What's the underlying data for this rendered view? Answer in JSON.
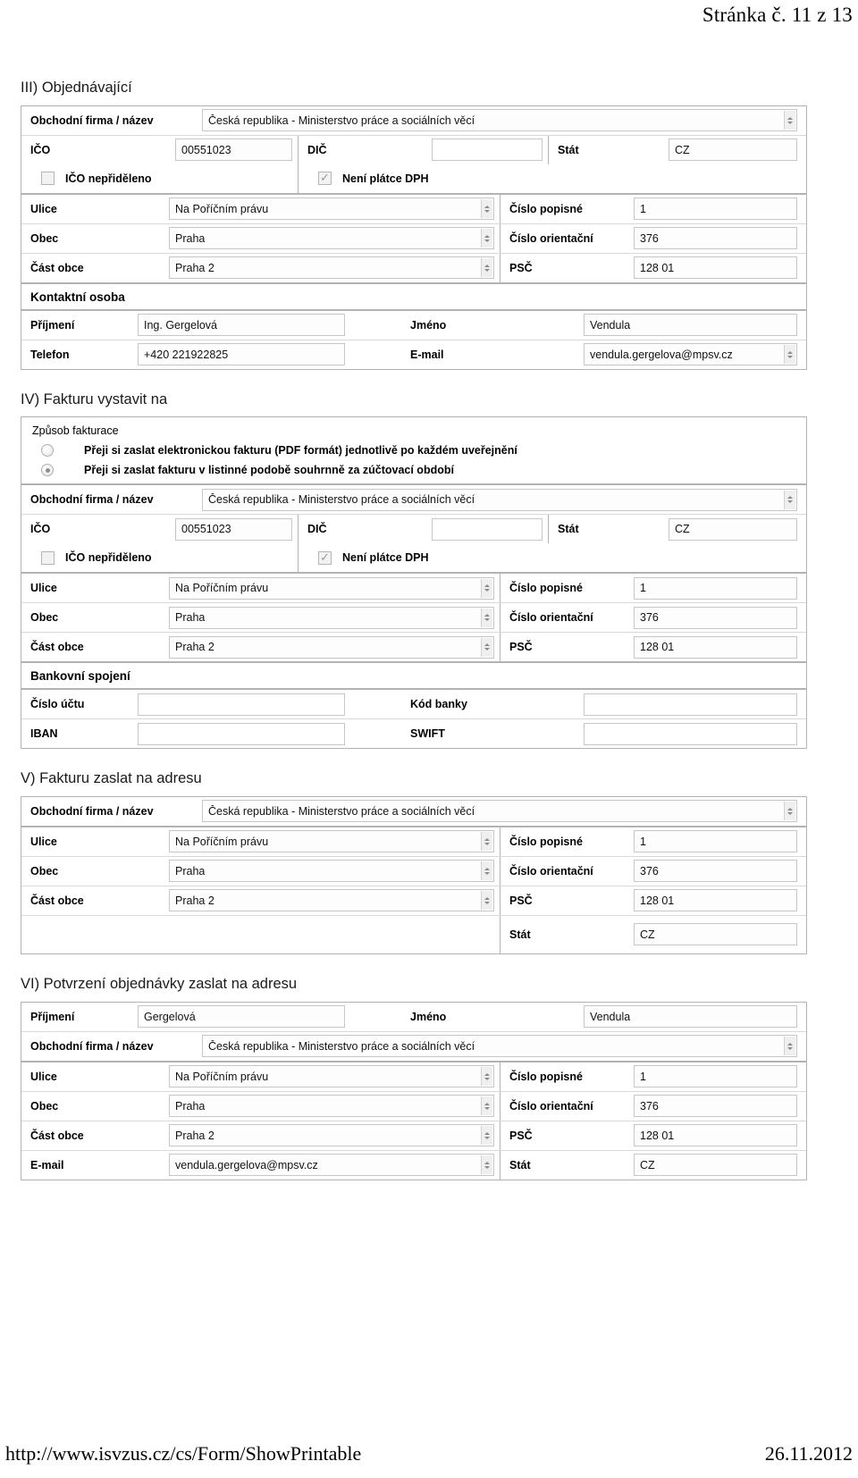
{
  "page": {
    "header": "Stránka č. 11 z 13",
    "footer_url": "http://www.isvzus.cz/cs/Form/ShowPrintable",
    "footer_date": "26.11.2012"
  },
  "labels": {
    "company": "Obchodní firma / název",
    "ico": "IČO",
    "dic": "DIČ",
    "stat": "Stát",
    "ico_not_assigned": "IČO nepřiděleno",
    "not_vat_payer": "Není plátce DPH",
    "street": "Ulice",
    "municipality": "Obec",
    "municipality_part": "Část obce",
    "house_number": "Číslo popisné",
    "orientation_number": "Číslo orientační",
    "zip": "PSČ",
    "contact_person": "Kontaktní osoba",
    "surname": "Příjmení",
    "firstname": "Jméno",
    "phone": "Telefon",
    "email": "E-mail",
    "bank_connection": "Bankovní spojení",
    "account_number": "Číslo účtu",
    "bank_code": "Kód banky",
    "iban": "IBAN",
    "swift": "SWIFT",
    "billing_method": "Způsob fakturace"
  },
  "sections": {
    "s3": {
      "title": "III) Objednávající"
    },
    "s4": {
      "title": "IV) Fakturu vystavit na"
    },
    "s5": {
      "title": "V) Fakturu zaslat na adresu"
    },
    "s6": {
      "title": "VI) Potvrzení objednávky zaslat na adresu"
    }
  },
  "orderer": {
    "company": "Česká republika - Ministerstvo práce a sociálních věcí",
    "ico": "00551023",
    "dic": "",
    "stat": "CZ",
    "ico_not_assigned_checked": false,
    "not_vat_payer_checked": true,
    "street": "Na Poříčním právu",
    "house_number": "1",
    "municipality": "Praha",
    "orientation_number": "376",
    "municipality_part": "Praha 2",
    "zip": "128 01",
    "contact": {
      "surname": "Ing. Gergelová",
      "firstname": "Vendula",
      "phone": "+420 221922825",
      "email": "vendula.gergelova@mpsv.cz"
    }
  },
  "invoice_to": {
    "options": [
      {
        "text": "Přeji si zaslat elektronickou fakturu (PDF formát) jednotlivě po každém uveřejnění",
        "selected": false
      },
      {
        "text": "Přeji si zaslat fakturu v listinné podobě souhrnně za zúčtovací období",
        "selected": true
      }
    ],
    "company": "Česká republika - Ministerstvo práce a sociálních věcí",
    "ico": "00551023",
    "dic": "",
    "stat": "CZ",
    "ico_not_assigned_checked": false,
    "not_vat_payer_checked": true,
    "street": "Na Poříčním právu",
    "house_number": "1",
    "municipality": "Praha",
    "orientation_number": "376",
    "municipality_part": "Praha 2",
    "zip": "128 01",
    "bank": {
      "account_number": "",
      "bank_code": "",
      "iban": "",
      "swift": ""
    }
  },
  "invoice_address": {
    "company": "Česká republika - Ministerstvo práce a sociálních věcí",
    "street": "Na Poříčním právu",
    "house_number": "1",
    "municipality": "Praha",
    "orientation_number": "376",
    "municipality_part": "Praha 2",
    "zip": "128 01",
    "stat": "CZ"
  },
  "confirmation_address": {
    "surname": "Gergelová",
    "firstname": "Vendula",
    "company": "Česká republika - Ministerstvo práce a sociálních věcí",
    "street": "Na Poříčním právu",
    "house_number": "1",
    "municipality": "Praha",
    "orientation_number": "376",
    "municipality_part": "Praha 2",
    "zip": "128 01",
    "email": "vendula.gergelova@mpsv.cz",
    "stat": "CZ"
  }
}
